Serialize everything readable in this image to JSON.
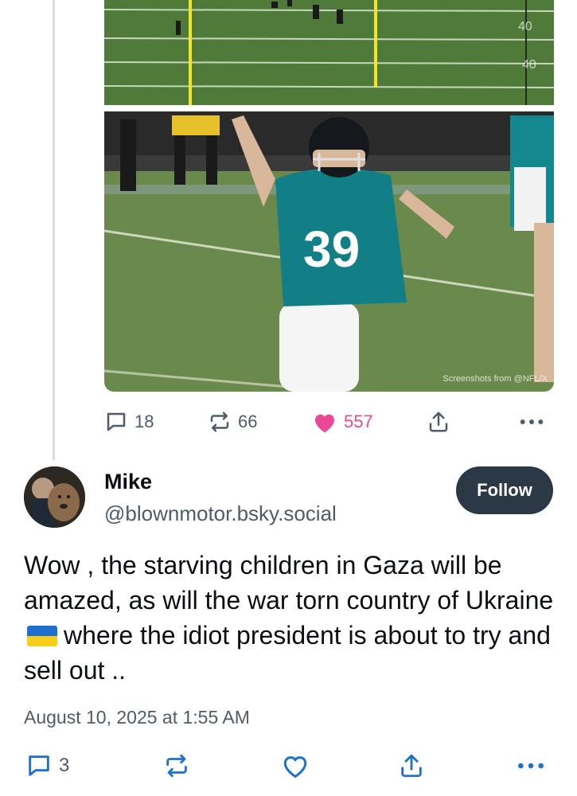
{
  "post1": {
    "media": {
      "watermark": "Screenshots from @NFL/X",
      "jersey_number": "39"
    },
    "actions": {
      "replies": "18",
      "reposts": "66",
      "likes": "557"
    },
    "colors": {
      "like_pink": "#ec4899",
      "muted": "#4f5b68"
    }
  },
  "post2": {
    "author": {
      "name": "Mike",
      "handle": "@blownmotor.bsky.social"
    },
    "follow_label": "Follow",
    "text_parts": {
      "before_flag": "Wow , the starving children in Gaza will be amazed, as will the war torn country of Ukraine",
      "flag": "🇺🇦",
      "after_flag": "where the idiot president is about to try and sell out .."
    },
    "timestamp": "August 10, 2025 at 1:55 AM",
    "actions": {
      "replies": "3"
    }
  },
  "icons": {
    "reply": "speech-bubble-icon",
    "repost": "repost-arrows-icon",
    "like": "heart-icon",
    "share": "share-upload-icon",
    "more": "ellipsis-icon"
  }
}
